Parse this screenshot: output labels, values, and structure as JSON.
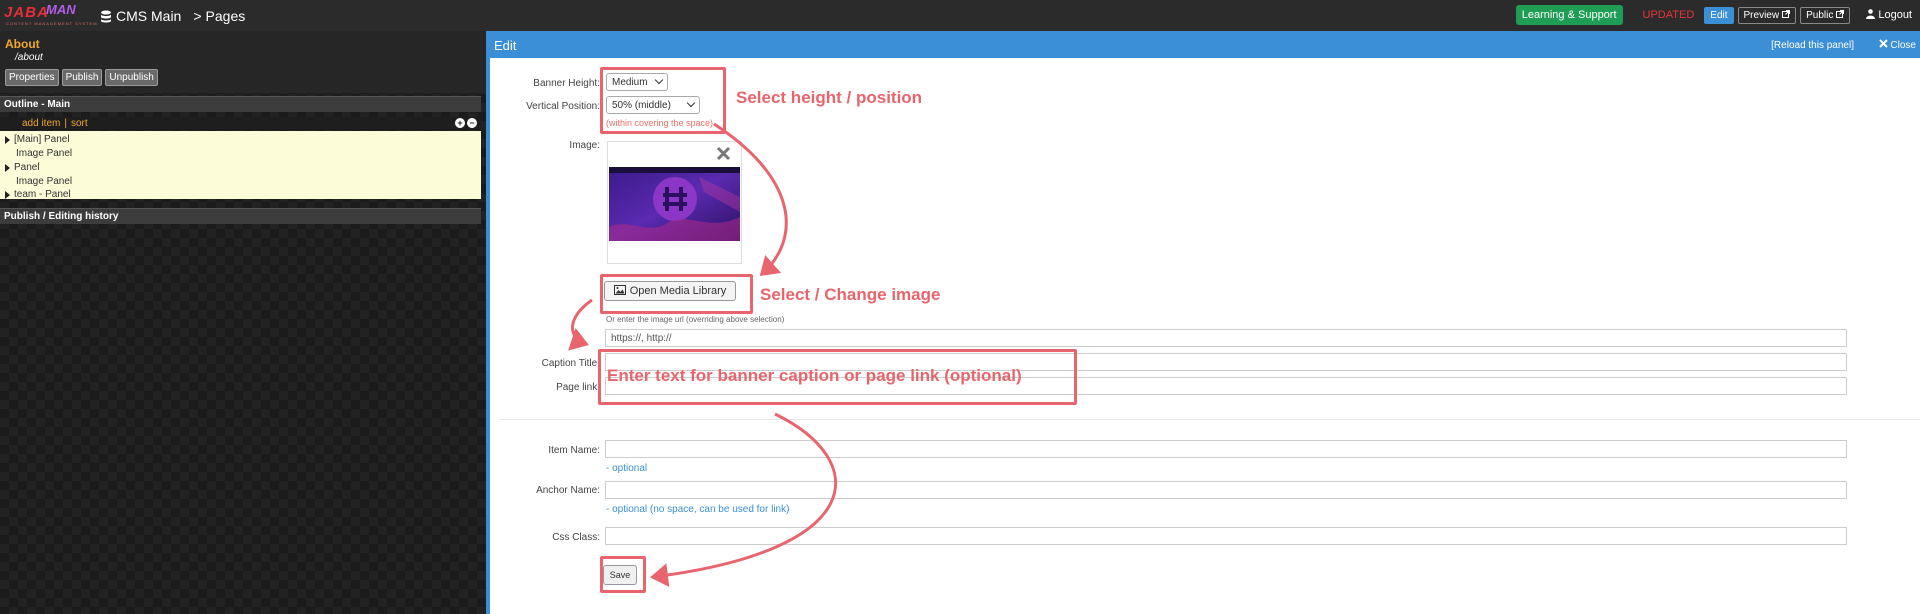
{
  "topbar": {
    "logo_main": "JABA",
    "logo_accent": "MAN",
    "logo_tagline": "CONTENT MANAGEMENT SYSTEM",
    "cms_label": "CMS Main",
    "crumb_sep": ">",
    "crumb_page": "Pages",
    "support_label": "Learning & Support",
    "updated_label": "UPDATED",
    "edit_label": "Edit",
    "preview_label": "Preview",
    "public_label": "Public",
    "logout_label": "Logout"
  },
  "left": {
    "page_title": "About",
    "page_path": "/about",
    "buttons": [
      "Properties",
      "Publish",
      "Unpublish"
    ],
    "outline_title": "Outline - Main",
    "add_item": "add item",
    "separator": "|",
    "sort": "sort",
    "items": [
      {
        "label": "[Main] Panel",
        "expandable": true
      },
      {
        "label": "Image Panel",
        "expandable": false
      },
      {
        "label": "Panel",
        "expandable": true
      },
      {
        "label": "Image Panel",
        "expandable": false
      },
      {
        "label": "team - Panel",
        "expandable": true
      }
    ],
    "history_title": "Publish / Editing history"
  },
  "edit": {
    "title": "Edit",
    "reload": "[Reload this panel]",
    "close": "Close",
    "banner_height_label": "Banner Height:",
    "banner_height_value": "Medium",
    "vertical_position_label": "Vertical Position:",
    "vertical_position_value": "50% (middle)",
    "position_hint": "(within covering the space)",
    "image_label": "Image:",
    "media_button": "Open Media Library",
    "url_note": "Or enter the image url (overriding above selection)",
    "url_placeholder": "https://, http://",
    "caption_label": "Caption Title:",
    "page_link_label": "Page link:",
    "item_name_label": "Item Name:",
    "item_name_hint": "- optional",
    "anchor_name_label": "Anchor Name:",
    "anchor_name_hint": "- optional (no space, can be used for link)",
    "css_class_label": "Css Class:",
    "save_label": "Save"
  },
  "annotations": {
    "height_position": "Select height / position",
    "change_image": "Select / Change image",
    "caption_link": "Enter text for banner caption or page link (optional)"
  },
  "colors": {
    "accent_blue": "#3b8fd6",
    "annotation_red": "#e8656d",
    "updated_red": "#e8363a",
    "support_green": "#1f9d55",
    "page_title_orange": "#f0a72a",
    "outline_bg": "#fcfcd9"
  },
  "icons": {
    "cms": "database-icon",
    "preview": "external-link-icon",
    "public": "external-link-icon",
    "logout": "user-icon",
    "close": "close-icon",
    "remove_image": "close-icon",
    "media": "image-icon"
  }
}
